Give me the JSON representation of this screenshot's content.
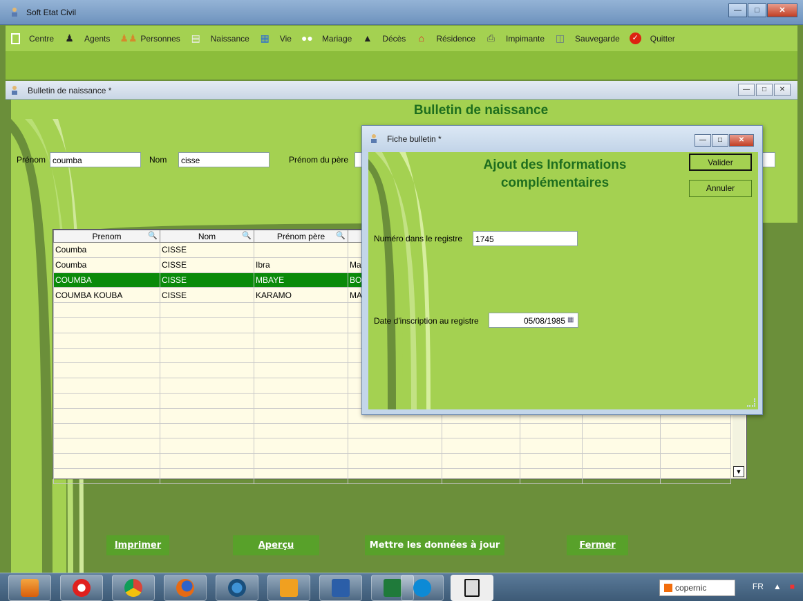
{
  "app": {
    "title": "Soft Etat Civil"
  },
  "menu": [
    {
      "label": "Centre",
      "icon": "doc-icon"
    },
    {
      "label": "Agents",
      "icon": "agent-icon"
    },
    {
      "label": "Personnes",
      "icon": "people-icon"
    },
    {
      "label": "Naissance",
      "icon": "birth-icon"
    },
    {
      "label": "Vie",
      "icon": "life-icon"
    },
    {
      "label": "Mariage",
      "icon": "marriage-icon"
    },
    {
      "label": "Décès",
      "icon": "death-icon"
    },
    {
      "label": "Résidence",
      "icon": "home-icon"
    },
    {
      "label": "Impimante",
      "icon": "printer-icon"
    },
    {
      "label": "Sauvegarde",
      "icon": "backup-icon"
    },
    {
      "label": "Quitter",
      "icon": "quit-icon"
    }
  ],
  "child": {
    "title": "Bulletin de naissance *",
    "heading": "Bulletin de naissance"
  },
  "form": {
    "prenom_label": "Prénom",
    "prenom_value": "coumba",
    "nom_label": "Nom",
    "nom_value": "cisse",
    "pere_label": "Prénom du père"
  },
  "table": {
    "columns": [
      "Prenom",
      "Nom",
      "Prénom père",
      ""
    ],
    "rows": [
      [
        "Coumba",
        "CISSE",
        "",
        ""
      ],
      [
        "Coumba",
        "CISSE",
        "Ibra",
        "Mag"
      ],
      [
        "COUMBA",
        "CISSE",
        "MBAYE",
        "BO"
      ],
      [
        "COUMBA KOUBA",
        "CISSE",
        "KARAMO",
        "MA"
      ]
    ],
    "selected_row": 2
  },
  "buttons": {
    "imprimer": "Imprimer",
    "apercu": "Aperçu",
    "maj": "Mettre les données à jour",
    "fermer": "Fermer"
  },
  "dialog": {
    "title": "Fiche bulletin *",
    "heading_line1": "Ajout des Informations",
    "heading_line2": "complémentaires",
    "valider": "Valider",
    "annuler": "Annuler",
    "numero_label": "Numéro dans le registre",
    "numero_value": "1745",
    "date_label": "Date d'inscription au registre",
    "date_value": "05/08/1985"
  },
  "taskbar": {
    "copernic": "copernic",
    "lang": "FR"
  },
  "colors": {
    "accent": "#a4d151",
    "dark_green": "#6b8f3a",
    "selected": "#0a8a0a",
    "heading": "#1e6e1e"
  }
}
